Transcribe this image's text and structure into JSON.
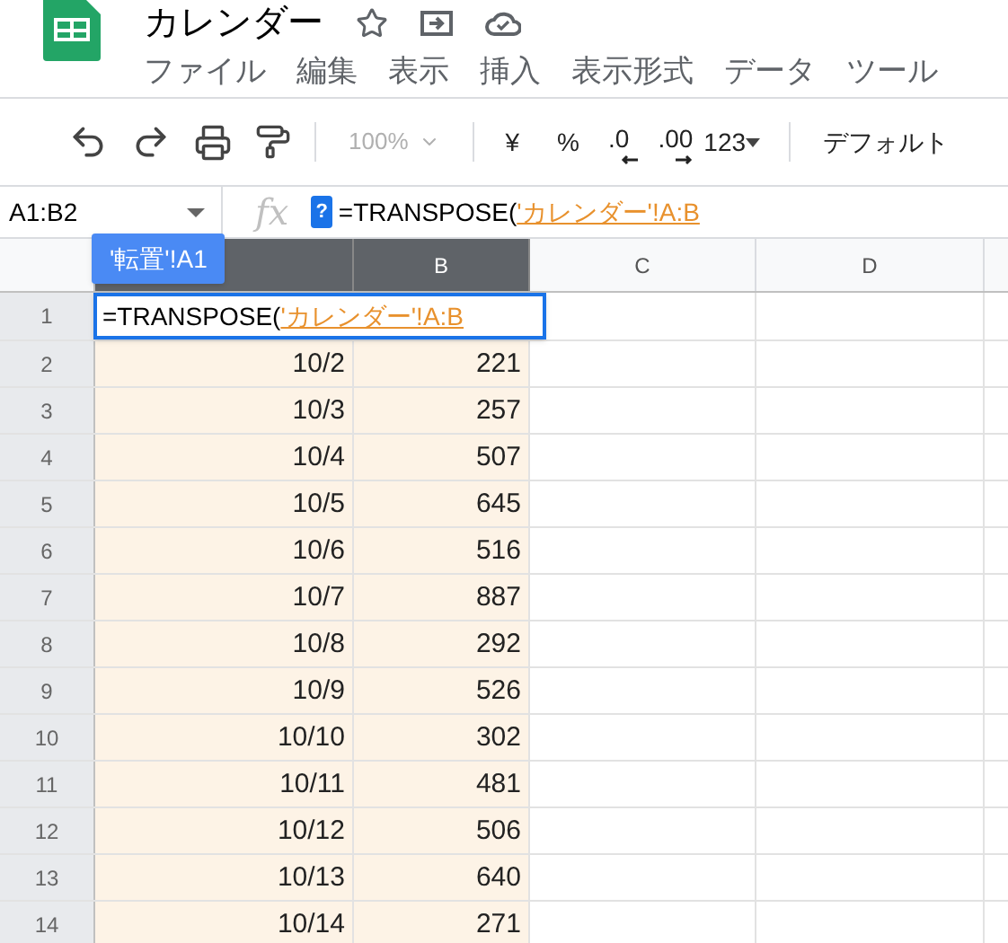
{
  "document": {
    "title": "カレンダー"
  },
  "menu": [
    "ファイル",
    "編集",
    "表示",
    "挿入",
    "表示形式",
    "データ",
    "ツール"
  ],
  "toolbar": {
    "zoom": {
      "label": "100%",
      "disabled": true
    },
    "currency": "¥",
    "percent": "%",
    "decrease_decimals": ".0",
    "increase_decimals": ".00",
    "number_format": "123",
    "font": "デフォルト"
  },
  "formula_bar": {
    "name_box": "A1:B2",
    "fx": "fx",
    "help": "?",
    "formula": "=TRANSPOSE(",
    "reference": "'カレンダー'!A:B"
  },
  "range_tooltip": "'転置'!A1",
  "columns": [
    {
      "selected": true
    },
    {
      "label": "B",
      "selected": true
    },
    {
      "label": "C",
      "selected": false
    },
    {
      "label": "D",
      "selected": false
    }
  ],
  "cell_editor": {
    "formula": "=TRANSPOSE(",
    "reference": "'カレンダー'!A:B"
  },
  "rows": [
    {
      "number": "1",
      "cells": []
    },
    {
      "number": "2",
      "cells": [
        "10/2",
        "221"
      ]
    },
    {
      "number": "3",
      "cells": [
        "10/3",
        "257"
      ]
    },
    {
      "number": "4",
      "cells": [
        "10/4",
        "507"
      ]
    },
    {
      "number": "5",
      "cells": [
        "10/5",
        "645"
      ]
    },
    {
      "number": "6",
      "cells": [
        "10/6",
        "516"
      ]
    },
    {
      "number": "7",
      "cells": [
        "10/7",
        "887"
      ]
    },
    {
      "number": "8",
      "cells": [
        "10/8",
        "292"
      ]
    },
    {
      "number": "9",
      "cells": [
        "10/9",
        "526"
      ]
    },
    {
      "number": "10",
      "cells": [
        "10/10",
        "302"
      ]
    },
    {
      "number": "11",
      "cells": [
        "10/11",
        "481"
      ]
    },
    {
      "number": "12",
      "cells": [
        "10/12",
        "506"
      ]
    },
    {
      "number": "13",
      "cells": [
        "10/13",
        "640"
      ]
    },
    {
      "number": "14",
      "cells": [
        "10/14",
        "271"
      ]
    }
  ]
}
